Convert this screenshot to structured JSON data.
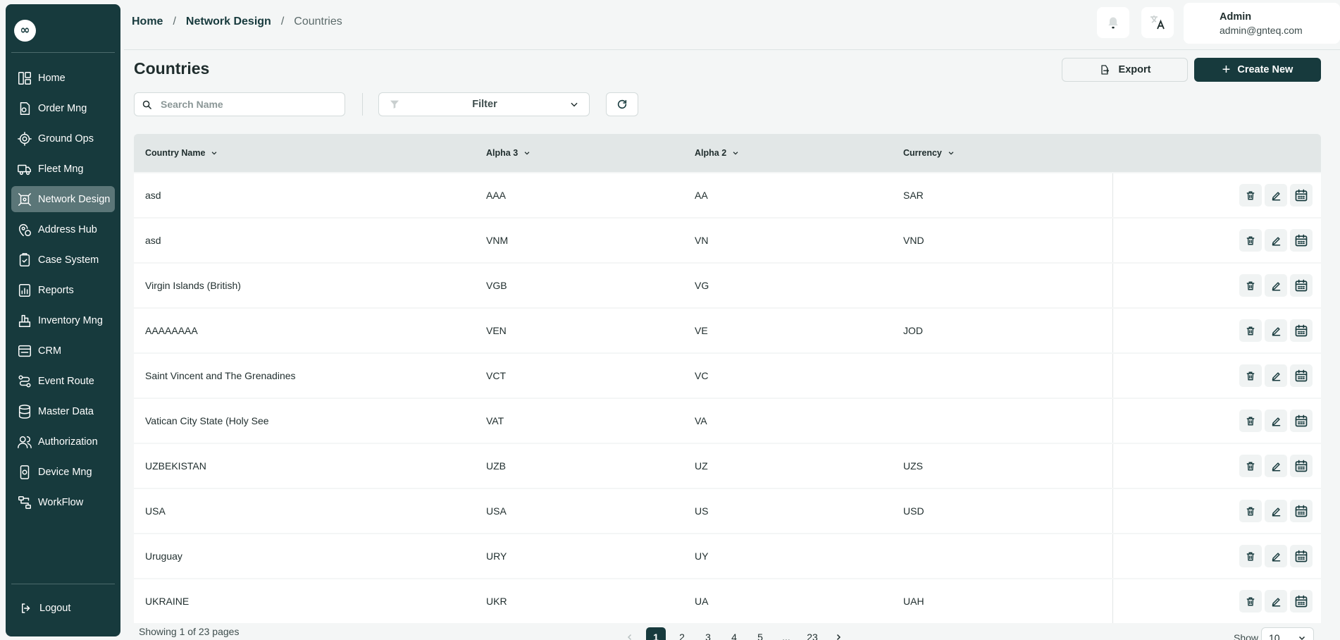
{
  "brand": {
    "logo_glyph": "∞",
    "color": "#173a3d"
  },
  "sidebar": {
    "items": [
      {
        "label": "Home",
        "icon": "layout-icon",
        "active": false
      },
      {
        "label": "Order Mng",
        "icon": "order-icon",
        "active": false
      },
      {
        "label": "Ground Ops",
        "icon": "ground-ops-icon",
        "active": false
      },
      {
        "label": "Fleet Mng",
        "icon": "truck-icon",
        "active": false
      },
      {
        "label": "Network Design",
        "icon": "network-icon",
        "active": true
      },
      {
        "label": "Address Hub",
        "icon": "map-pin-icon",
        "active": false
      },
      {
        "label": "Case System",
        "icon": "case-icon",
        "active": false
      },
      {
        "label": "Reports",
        "icon": "report-icon",
        "active": false
      },
      {
        "label": "Inventory Mng",
        "icon": "inventory-icon",
        "active": false
      },
      {
        "label": "CRM",
        "icon": "crm-icon",
        "active": false
      },
      {
        "label": "Event Route",
        "icon": "route-icon",
        "active": false
      },
      {
        "label": "Master Data",
        "icon": "database-icon",
        "active": false
      },
      {
        "label": "Authorization",
        "icon": "users-icon",
        "active": false
      },
      {
        "label": "Device Mng",
        "icon": "device-icon",
        "active": false
      },
      {
        "label": "WorkFlow",
        "icon": "workflow-icon",
        "active": false
      }
    ],
    "logout_label": "Logout"
  },
  "breadcrumb": {
    "items": [
      "Home",
      "Network Design",
      "Countries"
    ],
    "separator": "/"
  },
  "user": {
    "name": "Admin",
    "email": "admin@gnteq.com"
  },
  "page": {
    "title": "Countries",
    "export_label": "Export",
    "create_label": "Create New"
  },
  "toolbar": {
    "search_placeholder": "Search Name",
    "filter_label": "Filter"
  },
  "table": {
    "columns": [
      "Country Name",
      "Alpha 3",
      "Alpha 2",
      "Currency"
    ],
    "rows": [
      {
        "name": "asd",
        "alpha3": "AAA",
        "alpha2": "AA",
        "currency": "SAR"
      },
      {
        "name": "asd",
        "alpha3": "VNM",
        "alpha2": "VN",
        "currency": "VND"
      },
      {
        "name": "Virgin Islands (British)",
        "alpha3": "VGB",
        "alpha2": "VG",
        "currency": ""
      },
      {
        "name": "AAAAAAAA",
        "alpha3": "VEN",
        "alpha2": "VE",
        "currency": "JOD"
      },
      {
        "name": "Saint Vincent and The Grenadines",
        "alpha3": "VCT",
        "alpha2": "VC",
        "currency": ""
      },
      {
        "name": "Vatican City State (Holy See",
        "alpha3": "VAT",
        "alpha2": "VA",
        "currency": ""
      },
      {
        "name": "UZBEKISTAN",
        "alpha3": "UZB",
        "alpha2": "UZ",
        "currency": "UZS"
      },
      {
        "name": "USA",
        "alpha3": "USA",
        "alpha2": "US",
        "currency": "USD"
      },
      {
        "name": "Uruguay",
        "alpha3": "URY",
        "alpha2": "UY",
        "currency": ""
      },
      {
        "name": "UKRAINE",
        "alpha3": "UKR",
        "alpha2": "UA",
        "currency": "UAH"
      }
    ]
  },
  "pagination": {
    "showing_text": "Showing 1 of 23 pages",
    "pages": [
      "1",
      "2",
      "3",
      "4",
      "5",
      "...",
      "23"
    ],
    "current": "1",
    "show_label": "Show",
    "page_size": "10"
  }
}
